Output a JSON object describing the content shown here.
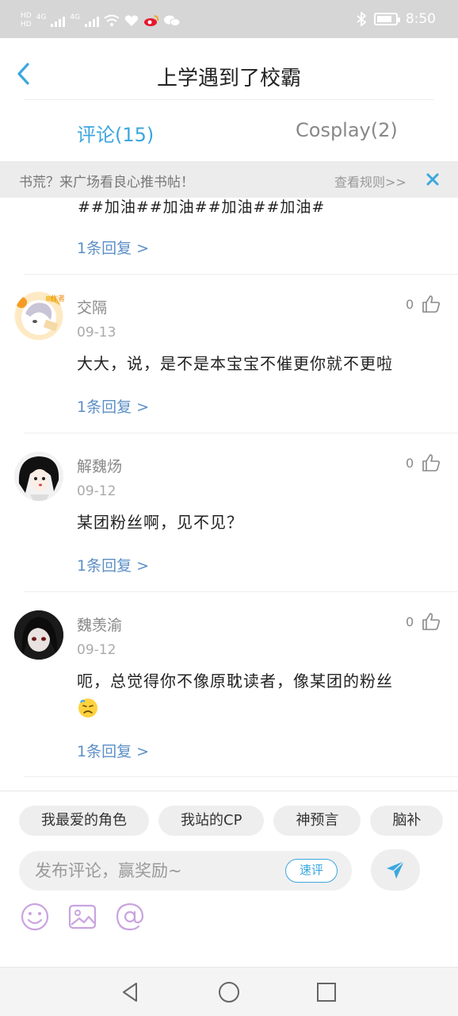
{
  "status_bar": {
    "time": "8:50",
    "network_labels": [
      "4G",
      "4G"
    ],
    "hd_labels": [
      "HD",
      "HD"
    ],
    "icons": [
      "signal-icon",
      "wifi-icon",
      "health-icon",
      "weibo-icon",
      "wechat-icon",
      "bluetooth-icon",
      "battery-icon"
    ]
  },
  "header": {
    "title": "上学遇到了校霸",
    "back_icon": "chevron-left-icon"
  },
  "tabs": [
    {
      "label": "评论(15)",
      "active": true
    },
    {
      "label": "Cosplay(2)",
      "active": false
    }
  ],
  "notice": {
    "text": "书荒？来广场看良心推书帖！",
    "rules_label": "查看规则>>",
    "close_icon": "close-icon"
  },
  "partial_comment": {
    "text": "##加油##加油##加油##加油#",
    "reply_label": "1条回复 >"
  },
  "comments": [
    {
      "name": "交隔",
      "date": "09-13",
      "text": "大大，说，是不是本宝宝不催更你就不更啦",
      "likes": "0",
      "reply_label": "1条回复 >",
      "badge": "作者"
    },
    {
      "name": "解魏炀",
      "date": "09-12",
      "text": "某团粉丝啊，见不见？",
      "likes": "0",
      "reply_label": "1条回复 >"
    },
    {
      "name": "魏羡渝",
      "date": "09-12",
      "text": "呃，总觉得你不像原耽读者，像某团的粉丝",
      "likes": "0",
      "reply_label": "1条回复 >"
    }
  ],
  "composer": {
    "chips": [
      "我最爱的角色",
      "我站的CP",
      "神预言",
      "脑补"
    ],
    "placeholder": "发布评论，赢奖励~",
    "quick_label": "速评",
    "send_icon": "send-icon",
    "tools": [
      "emoji-icon",
      "image-icon",
      "at-icon"
    ]
  },
  "colors": {
    "accent": "#3ba7df",
    "link": "#5c8fc6",
    "tool_purple": "#c9a4e0"
  },
  "navbar": {
    "icons": [
      "back-triangle-icon",
      "home-circle-icon",
      "recents-square-icon"
    ]
  }
}
